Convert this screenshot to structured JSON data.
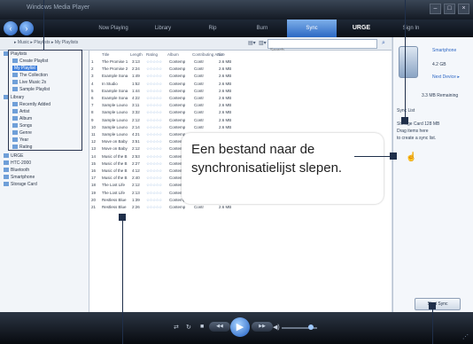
{
  "window": {
    "title": "Windows Media Player"
  },
  "nav_tabs": [
    "Now Playing",
    "Library",
    "Rip",
    "Burn",
    "Sync",
    "URGE",
    "Sign In"
  ],
  "address": {
    "breadcrumb": "▸ Music ▸ Playlists ▸ My Playlists",
    "search_placeholder": "Search"
  },
  "tree": [
    {
      "label": "Playlists"
    },
    {
      "label": "Create Playlist"
    },
    {
      "label": "My Playlist",
      "selected": true
    },
    {
      "label": "The Collection"
    },
    {
      "label": "Live Music 2x"
    },
    {
      "label": "Sample Playlist"
    },
    {
      "label": "Library"
    },
    {
      "label": "Recently Added"
    },
    {
      "label": "Artist"
    },
    {
      "label": "Album"
    },
    {
      "label": "Songs"
    },
    {
      "label": "Genre"
    },
    {
      "label": "Year"
    },
    {
      "label": "Rating"
    },
    {
      "label": "URGE"
    },
    {
      "label": "HTC-2000"
    },
    {
      "label": "Bluetooth"
    },
    {
      "label": "Smartphone"
    },
    {
      "label": "Storage Card"
    }
  ],
  "columns": [
    "Title",
    "Length",
    "Rating",
    "Album",
    "Contributing Artist",
    "Size"
  ],
  "tracks": [
    {
      "num": "1",
      "title": "The Promise 1",
      "length": "3:13",
      "album": "Contemp",
      "artist": "Contr",
      "size": "2.6 MB"
    },
    {
      "num": "2",
      "title": "The Promise 2",
      "length": "2:24",
      "album": "Contemp",
      "artist": "Contr",
      "size": "2.6 MB"
    },
    {
      "num": "3",
      "title": "Example Sona",
      "length": "1:49",
      "album": "Contemp",
      "artist": "Contr",
      "size": "2.6 MB"
    },
    {
      "num": "4",
      "title": "In Studio",
      "length": "1:52",
      "album": "Contemp",
      "artist": "Contr",
      "size": "2.6 MB"
    },
    {
      "num": "5",
      "title": "Example Sona",
      "length": "1:44",
      "album": "Contemp",
      "artist": "Contr",
      "size": "2.6 MB"
    },
    {
      "num": "6",
      "title": "Example Sona",
      "length": "4:22",
      "album": "Contemp",
      "artist": "Contr",
      "size": "2.6 MB"
    },
    {
      "num": "7",
      "title": "Sample Louno",
      "length": "3:11",
      "album": "Contemp",
      "artist": "Contr",
      "size": "2.6 MB"
    },
    {
      "num": "8",
      "title": "Sample Louno",
      "length": "3:32",
      "album": "Contemp",
      "artist": "Contr",
      "size": "2.6 MB"
    },
    {
      "num": "9",
      "title": "Sample Louno",
      "length": "2:12",
      "album": "Contemp",
      "artist": "Contr",
      "size": "2.6 MB"
    },
    {
      "num": "10",
      "title": "Sample Louno",
      "length": "2:14",
      "album": "Contemp",
      "artist": "Contr",
      "size": "2.6 MB"
    },
    {
      "num": "11",
      "title": "Sample Louno",
      "length": "4:21",
      "album": "Contemp",
      "artist": "Contr",
      "size": "2.6 MB"
    },
    {
      "num": "12",
      "title": "Move on Baby",
      "length": "3:51",
      "album": "Contemp",
      "artist": "Contr",
      "size": "2.6 MB"
    },
    {
      "num": "13",
      "title": "Move on Baby",
      "length": "2:12",
      "album": "Contemp",
      "artist": "Contr",
      "size": "2.6 MB"
    },
    {
      "num": "14",
      "title": "Music of the B",
      "length": "2:53",
      "album": "Contemp",
      "artist": "Contr",
      "size": "2.6 MB"
    },
    {
      "num": "15",
      "title": "Music of the B",
      "length": "2:27",
      "album": "Contemp",
      "artist": "Contr",
      "size": "2.6 MB"
    },
    {
      "num": "16",
      "title": "Music of the B",
      "length": "4:12",
      "album": "Contemp",
      "artist": "Contr",
      "size": "2.6 MB"
    },
    {
      "num": "17",
      "title": "Music of the B",
      "length": "2:40",
      "album": "Contemp",
      "artist": "Contr",
      "size": "2.6 MB"
    },
    {
      "num": "18",
      "title": "The Lost Life",
      "length": "2:12",
      "album": "Contemp",
      "artist": "Contr",
      "size": "2.6 MB"
    },
    {
      "num": "19",
      "title": "The Lost Life",
      "length": "2:13",
      "album": "Contemp",
      "artist": "Contr",
      "size": "2.6 MB"
    },
    {
      "num": "20",
      "title": "Restless Blue",
      "length": "1:39",
      "album": "Contemp",
      "artist": "Contr",
      "size": "2.6 MB"
    },
    {
      "num": "21",
      "title": "Restless Blue",
      "length": "2:26",
      "album": "Contemp",
      "artist": "Contr",
      "size": "2.6 MB"
    }
  ],
  "sync": {
    "device": "Smartphone",
    "capacity": "4.2 GB",
    "next_device": "Next Device ▸",
    "free": "3.3 MB Remaining",
    "list_title": "Sync List",
    "drag_hint": "Drag items here",
    "remaining_note": "to create a sync list.",
    "storage": "Storage Card 128 MB",
    "start_sync": "Start Sync"
  },
  "callout": {
    "text": "Een bestand naar de synchronisatielijst slepen."
  },
  "player": {
    "prev": "◀◀",
    "stop": "■",
    "play": "▶",
    "next": "▶▶",
    "vol": "◀)"
  }
}
